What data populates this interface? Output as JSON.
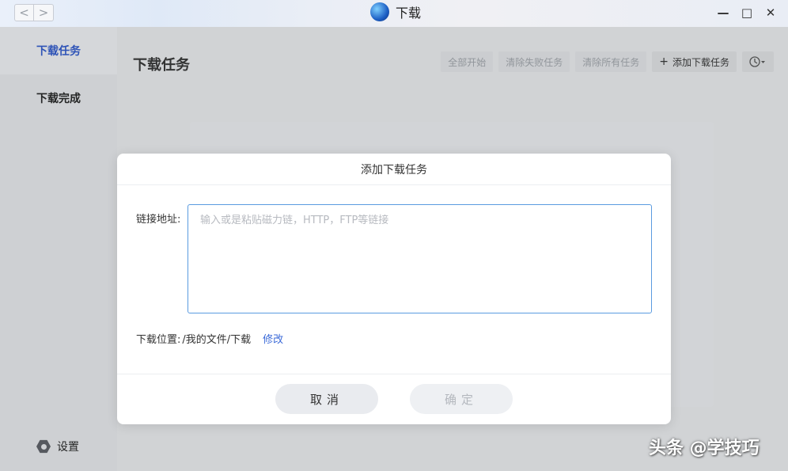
{
  "window": {
    "title": "下载",
    "nav_back": "<",
    "nav_forward": ">",
    "minimize": "—",
    "maximize": "□",
    "close": "✕"
  },
  "sidebar": {
    "items": [
      {
        "label": "下载任务",
        "active": true
      },
      {
        "label": "下载完成",
        "active": false
      }
    ],
    "settings_label": "设置"
  },
  "main": {
    "title": "下载任务",
    "toolbar": {
      "start_all": "全部开始",
      "clear_failed": "清除失败任务",
      "clear_all": "清除所有任务",
      "add_task": "添加下载任务",
      "add_plus": "+",
      "history_icon": "clock-icon"
    }
  },
  "dialog": {
    "title": "添加下载任务",
    "url_label": "链接地址:",
    "url_placeholder": "输入或是粘贴磁力链，HTTP，FTP等链接",
    "url_value": "",
    "location_label": "下载位置:",
    "location_path": "/我的文件/下载",
    "location_change": "修改",
    "cancel_label": "取消",
    "ok_label": "确定"
  },
  "watermark": "头条 @学技巧",
  "colors": {
    "accent": "#2d56c8",
    "link": "#3b6ad8",
    "input_border": "#5a9be0"
  }
}
